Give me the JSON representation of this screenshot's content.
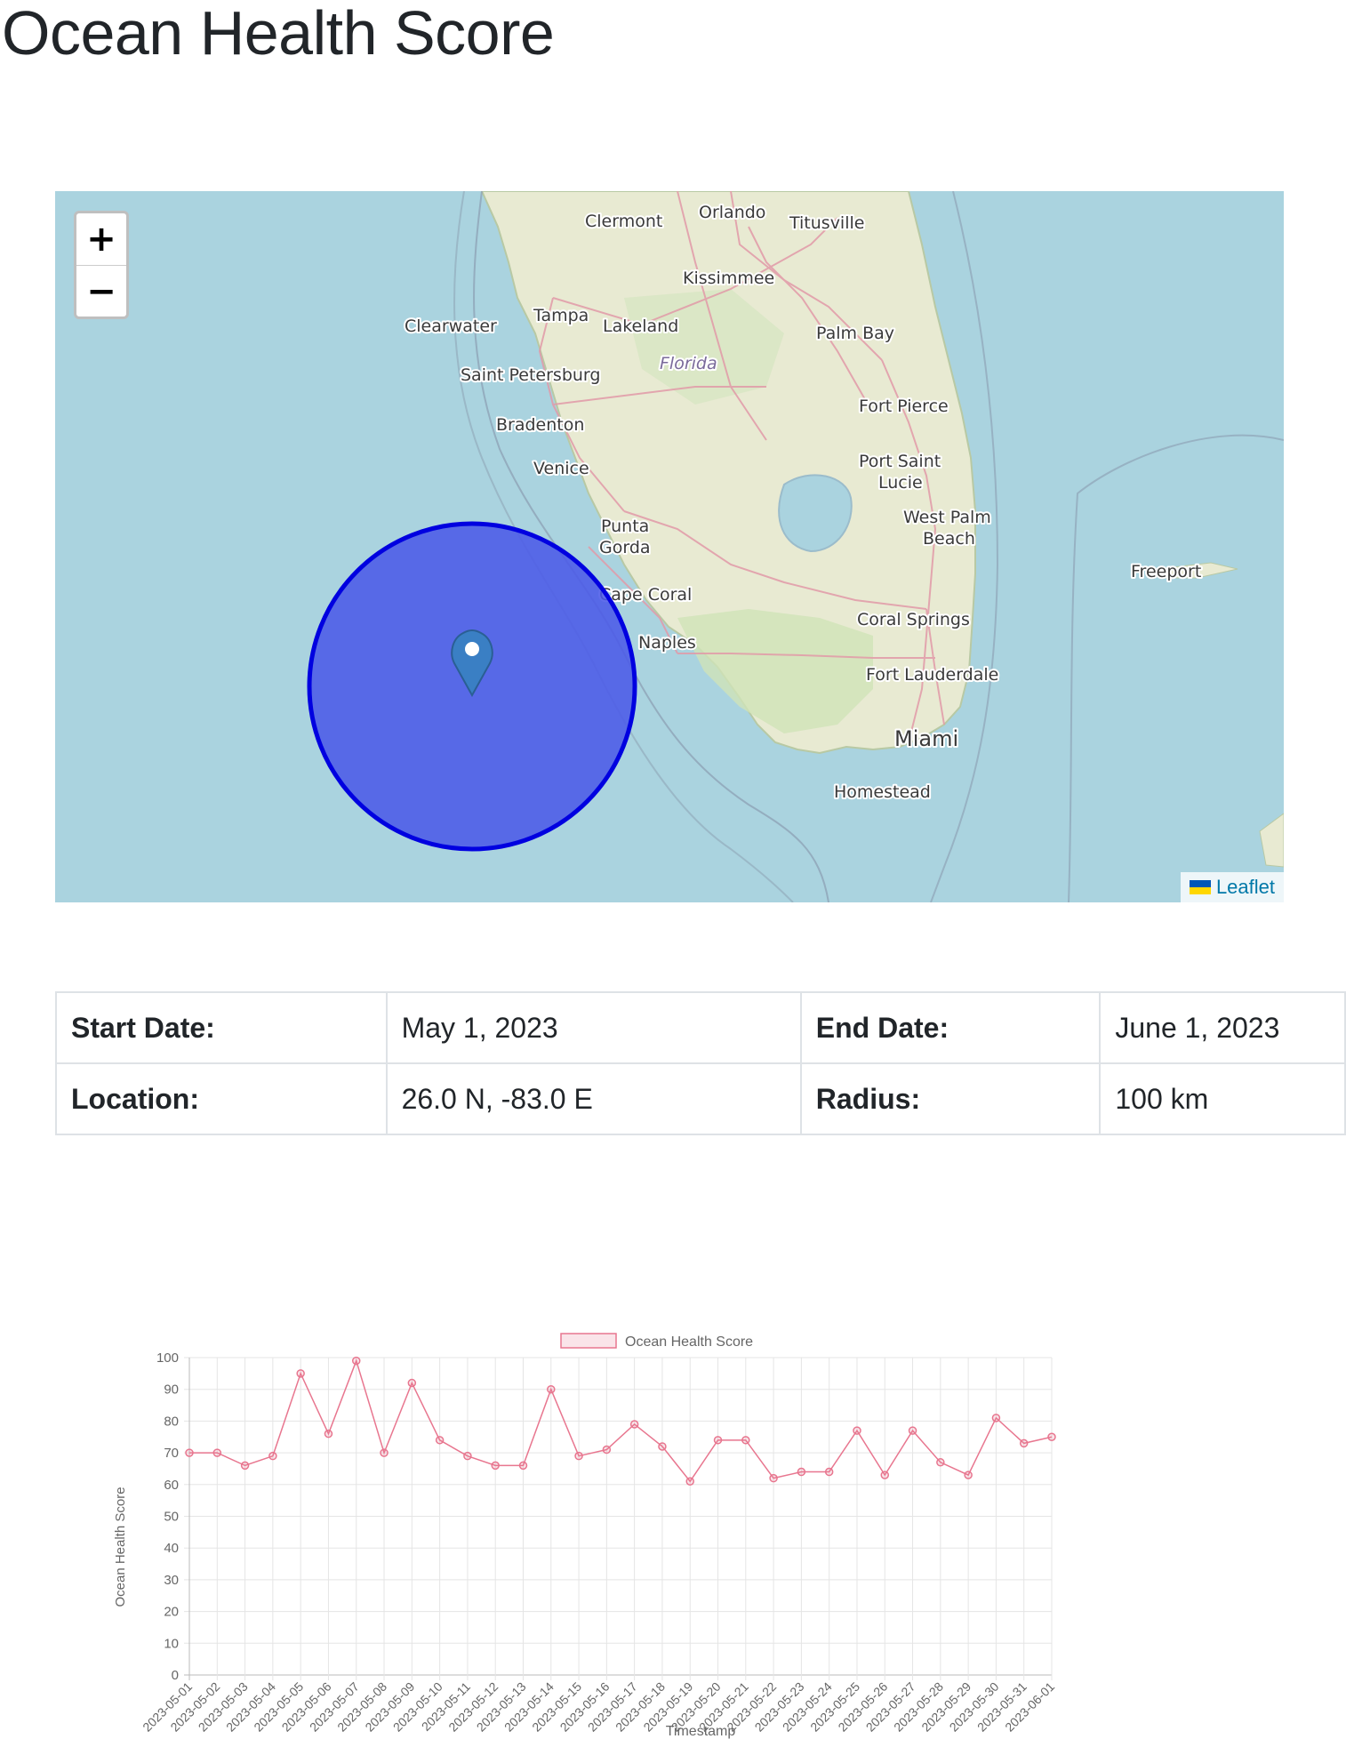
{
  "page_title": "Ocean Health Score",
  "map": {
    "zoom_in": "+",
    "zoom_out": "−",
    "attribution": "Leaflet",
    "flag_colors": [
      "#0057b7",
      "#ffd700"
    ],
    "circle_fill": "#4b5ae8",
    "circle_stroke": "#0000e0",
    "water_color": "#aad3df",
    "land_color": "#e8ead2",
    "place_labels": [
      "Orlando",
      "Clermont",
      "Titusville",
      "Kissimmee",
      "Tampa",
      "Clearwater",
      "Lakeland",
      "Palm Bay",
      "Florida",
      "Saint Petersburg",
      "Fort Pierce",
      "Bradenton",
      "Port Saint",
      "Lucie",
      "Venice",
      "West Palm",
      "Beach",
      "Punta",
      "Gorda",
      "Freeport",
      "Cape Coral",
      "Naples",
      "Coral Springs",
      "Fort Lauderdale",
      "Miami",
      "Homestead"
    ]
  },
  "info": {
    "start_label": "Start Date:",
    "start_value": "May 1, 2023",
    "end_label": "End Date:",
    "end_value": "June 1, 2023",
    "location_label": "Location:",
    "location_value": "26.0 N, -83.0 E",
    "radius_label": "Radius:",
    "radius_value": "100 km"
  },
  "chart_data": {
    "type": "line",
    "title": "",
    "legend": "Ocean Health Score",
    "legend_position": "top",
    "xlabel": "Timestamp",
    "ylabel": "Ocean Health Score",
    "ylim": [
      0,
      100
    ],
    "yticks": [
      0,
      10,
      20,
      30,
      40,
      50,
      60,
      70,
      80,
      90,
      100
    ],
    "grid": true,
    "color": "#e8768f",
    "categories": [
      "2023-05-01",
      "2023-05-02",
      "2023-05-03",
      "2023-05-04",
      "2023-05-05",
      "2023-05-06",
      "2023-05-07",
      "2023-05-08",
      "2023-05-09",
      "2023-05-10",
      "2023-05-11",
      "2023-05-12",
      "2023-05-13",
      "2023-05-14",
      "2023-05-15",
      "2023-05-16",
      "2023-05-17",
      "2023-05-18",
      "2023-05-19",
      "2023-05-20",
      "2023-05-21",
      "2023-05-22",
      "2023-05-23",
      "2023-05-24",
      "2023-05-25",
      "2023-05-26",
      "2023-05-27",
      "2023-05-28",
      "2023-05-29",
      "2023-05-30",
      "2023-05-31",
      "2023-06-01"
    ],
    "series": [
      {
        "name": "Ocean Health Score",
        "values": [
          70,
          70,
          66,
          69,
          95,
          76,
          99,
          70,
          92,
          74,
          69,
          66,
          66,
          90,
          69,
          71,
          79,
          72,
          61,
          74,
          74,
          62,
          64,
          64,
          77,
          63,
          77,
          67,
          63,
          81,
          73,
          75
        ]
      }
    ]
  }
}
